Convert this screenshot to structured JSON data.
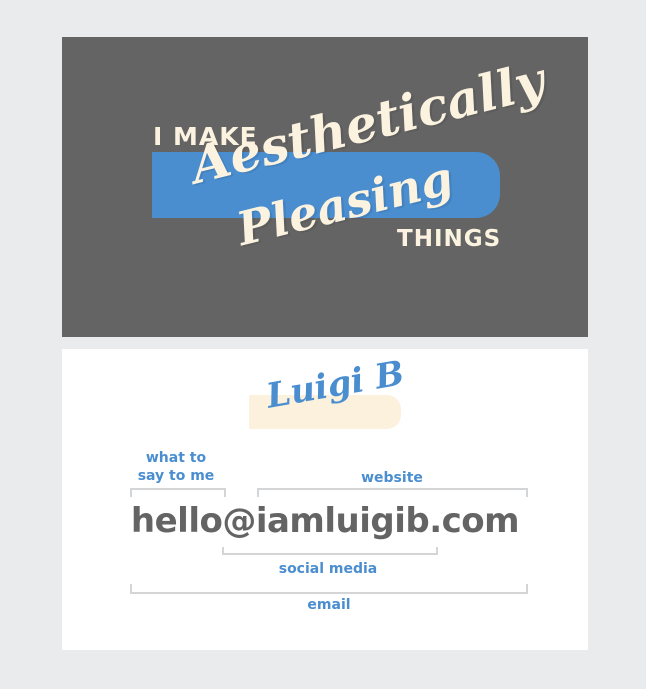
{
  "front": {
    "line1": "I MAKE",
    "script1": "Aesthetically",
    "script2": "Pleasing",
    "line2": "THINGS"
  },
  "back": {
    "logo": "Luigi B",
    "label_what": "what to\nsay to me",
    "label_website": "website",
    "email": "hello@iamluigib.com",
    "label_social": "social media",
    "label_email": "email"
  },
  "colors": {
    "page_background": "#eaebec",
    "front_background": "#646464",
    "accent_blue": "#4a8ed0",
    "cream": "#fbf3df",
    "text_gray": "#646464",
    "bracket_gray": "#d3d5d7"
  }
}
